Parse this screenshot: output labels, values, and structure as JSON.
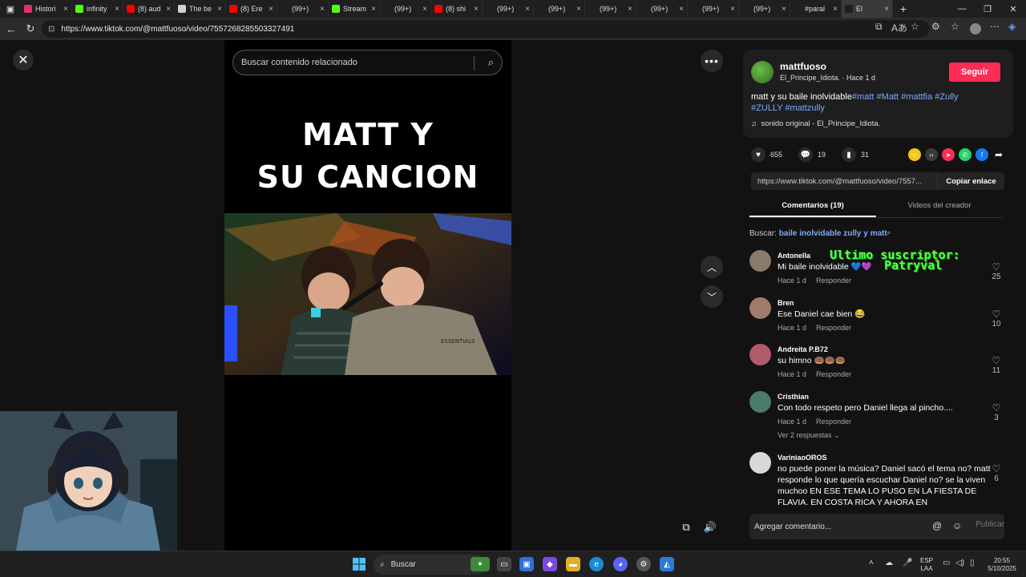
{
  "browser": {
    "tabs": [
      {
        "label": "Histori",
        "color": "#e1306c"
      },
      {
        "label": "infinity",
        "color": "#53fc18"
      },
      {
        "label": "(8) aud",
        "color": "#ff0000"
      },
      {
        "label": "The be",
        "color": "#d0d0d0"
      },
      {
        "label": "(8) Ere",
        "color": "#ff0000"
      },
      {
        "label": "(99+)",
        "color": "#1f1f1f"
      },
      {
        "label": "Stream",
        "color": "#53fc18"
      },
      {
        "label": "(99+)",
        "color": "#1f1f1f"
      },
      {
        "label": "(8) shi",
        "color": "#ff0000"
      },
      {
        "label": "(99+)",
        "color": "#1f1f1f"
      },
      {
        "label": "(99+)",
        "color": "#1f1f1f"
      },
      {
        "label": "(99+)",
        "color": "#1f1f1f"
      },
      {
        "label": "(99+)",
        "color": "#1f1f1f"
      },
      {
        "label": "(99+)",
        "color": "#1f1f1f"
      },
      {
        "label": "(99+)",
        "color": "#1f1f1f"
      },
      {
        "label": "#paral",
        "color": "#1f1f1f"
      },
      {
        "label": "El",
        "color": "#1f1f1f"
      }
    ],
    "new_tab": "+",
    "url": "https://www.tiktok.com/@mattfuoso/video/7557268285503327491"
  },
  "video": {
    "search_placeholder": "Buscar contenido relacionado",
    "title_line1": "MATT  Y",
    "title_line2": "SU CANCION"
  },
  "author": {
    "name": "mattfuoso",
    "sub": "El_Principe_Idiota. · Hace 1 d",
    "follow": "Seguir",
    "desc_text": "matt y su baile inolvidable",
    "desc_tags1": "#matt #Matt #mattfia #Zully",
    "desc_tags2": "#ZULLY #mattzully",
    "music": "sonido original - El_Principe_Idiota."
  },
  "stats": {
    "likes": "655",
    "comments": "19",
    "saves": "31"
  },
  "link": {
    "url": "https://www.tiktok.com/@mattfuoso/video/7557...",
    "copy": "Copiar enlace"
  },
  "tabs": {
    "comments": "Comentarios (19)",
    "creator": "Videos del creador"
  },
  "related": {
    "label": "Buscar:",
    "query": "baile inolvidable zully y matt"
  },
  "overlay": {
    "line1": "Último suscriptor:",
    "line2": "Patryval"
  },
  "comments": [
    {
      "user": "Antonella",
      "text": "Mi baile inolvidable 💙💜",
      "time": "Hace 1 d",
      "reply": "Responder",
      "likes": "25",
      "color": "#8a7a6a"
    },
    {
      "user": "Bren",
      "text": "Ese Daniel cae bien 😂",
      "time": "Hace 1 d",
      "reply": "Responder",
      "likes": "10",
      "color": "#a07a6a"
    },
    {
      "user": "Andreita P.B72",
      "text": "su himno 🍩🍩🍩",
      "time": "Hace 1 d",
      "reply": "Responder",
      "likes": "11",
      "color": "#b05a6a"
    },
    {
      "user": "Cristhian",
      "text": "Con todo respeto pero Daniel llega al pincho....",
      "time": "Hace 1 d",
      "reply": "Responder",
      "likes": "3",
      "color": "#4a7a6a",
      "replies": "Ver 2 respuestas"
    },
    {
      "user": "VariniaoOROS",
      "text": "no puede poner la música? Daniel sacó el tema no? matt responde lo que quería escuchar Daniel no? se la viven muchoo EN ESE TEMA LO PUSO EN LA FIESTA DE FLAVIA, EN COSTA RICA Y AHORA EN",
      "time": "",
      "reply": "",
      "likes": "6",
      "color": "#d8d8d8"
    }
  ],
  "comment_input": {
    "placeholder": "Agregar comentario...",
    "publish": "Publicar"
  },
  "taskbar": {
    "search": "Buscar",
    "lang1": "ESP",
    "lang2": "LAA",
    "time": "20:55",
    "date": "5/10/2025"
  }
}
